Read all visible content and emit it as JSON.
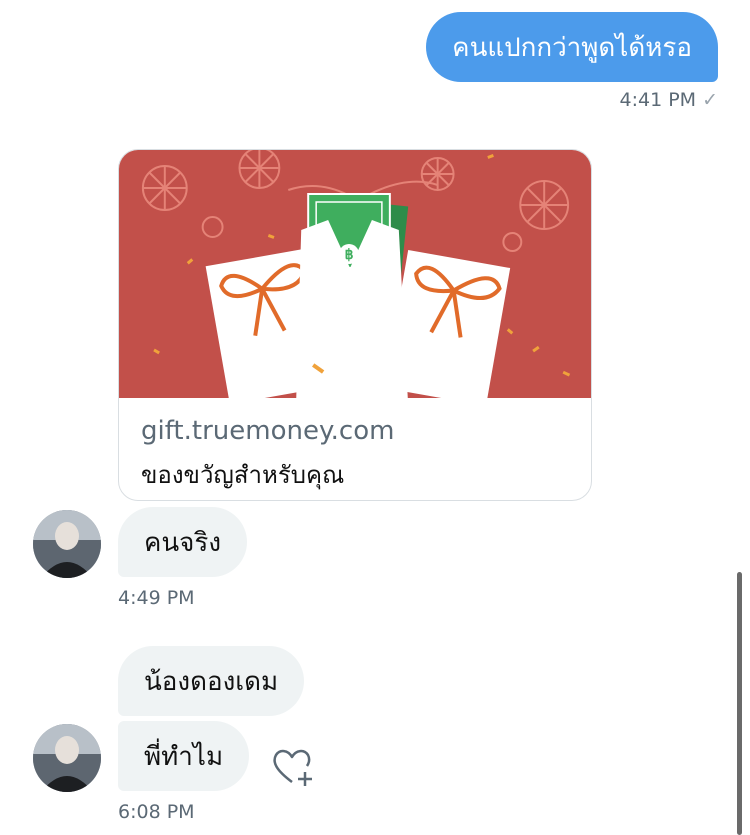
{
  "messages": {
    "sent": {
      "text": "คนแปกกว่าพูดได้หรอ",
      "time": "4:41 PM"
    },
    "link_card": {
      "domain": "gift.truemoney.com",
      "title": "ของขวัญสำหรับคุณ"
    },
    "received_1": {
      "text": "คนจริง",
      "time": "4:49 PM"
    },
    "received_2": {
      "text": "น้องดองเดม"
    },
    "received_3": {
      "text": "พี่ทำไม",
      "time": "6:08 PM"
    }
  },
  "icons": {
    "read_receipt": "checkmark-icon",
    "react": "heart-plus-icon"
  },
  "colors": {
    "sent_bubble": "#4c9beb",
    "received_bubble": "#eff3f4",
    "card_bg": "#c2504a",
    "timestamp": "#5b6975"
  }
}
